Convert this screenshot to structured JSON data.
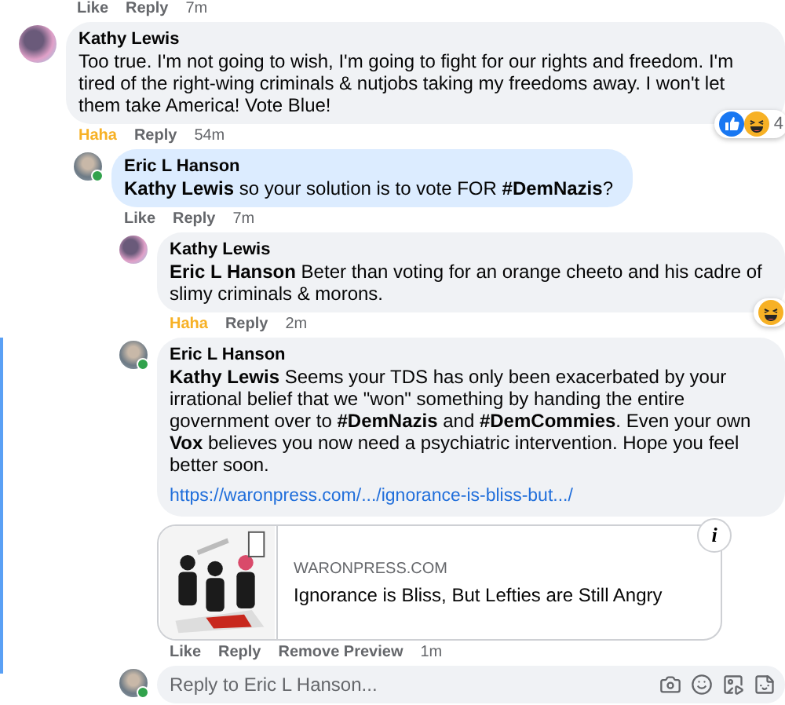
{
  "previous_actions": {
    "actions": [
      {
        "label": "Like",
        "reacted": false
      },
      {
        "label": "Reply",
        "reacted": false
      }
    ],
    "time": "7m"
  },
  "comments": [
    {
      "author": "Kathy Lewis",
      "online": false,
      "highlighted": false,
      "text": "Too true. I'm not going to wish, I'm going to fight for our rights and freedom. I'm tired of the right-wing criminals & nutjobs taking my freedoms away. I won't let them take America! Vote Blue!",
      "reactions": {
        "icons": [
          {
            "kind": "like"
          },
          {
            "kind": "haha"
          }
        ],
        "count": "4"
      },
      "actions": [
        {
          "label": "Haha",
          "reacted": true
        },
        {
          "label": "Reply",
          "reacted": false
        }
      ],
      "time": "54m",
      "children": [
        {
          "author": "Eric L Hanson",
          "online": true,
          "highlighted": true,
          "text": "**Kathy Lewis** so your solution is to vote FOR **#DemNazis**?",
          "actions": [
            {
              "label": "Like",
              "reacted": false
            },
            {
              "label": "Reply",
              "reacted": false
            }
          ],
          "time": "7m",
          "children": [
            {
              "author": "Kathy Lewis",
              "online": false,
              "highlighted": false,
              "text": "**Eric L Hanson** Beter than voting for an orange cheeto and his cadre of slimy criminals & morons.",
              "reactions": {
                "icons": [
                  {
                    "kind": "haha"
                  }
                ]
              },
              "actions": [
                {
                  "label": "Haha",
                  "reacted": true
                },
                {
                  "label": "Reply",
                  "reacted": false
                }
              ],
              "time": "2m"
            },
            {
              "author": "Eric L Hanson",
              "online": true,
              "highlighted": false,
              "text": "**Kathy Lewis** Seems your TDS has only been exacerbated by your irrational belief that we \"won\" something by handing the entire government over to **#DemNazis** and **#DemCommies**. Even your own **Vox** believes you now need a psychiatric intervention. Hope you feel better soon.",
              "link": "https://waronpress.com/.../ignorance-is-bliss-but.../",
              "preview": {
                "site": "WARONPRESS.COM",
                "title": "Ignorance is Bliss, But Lefties are Still Angry",
                "info": "i"
              },
              "actions": [
                {
                  "label": "Like",
                  "reacted": false
                },
                {
                  "label": "Reply",
                  "reacted": false
                },
                {
                  "label": "Remove Preview",
                  "reacted": false
                }
              ],
              "time": "1m"
            }
          ],
          "reply_box": {
            "placeholder": "Reply to Eric L Hanson...",
            "online": true
          }
        }
      ]
    }
  ]
}
